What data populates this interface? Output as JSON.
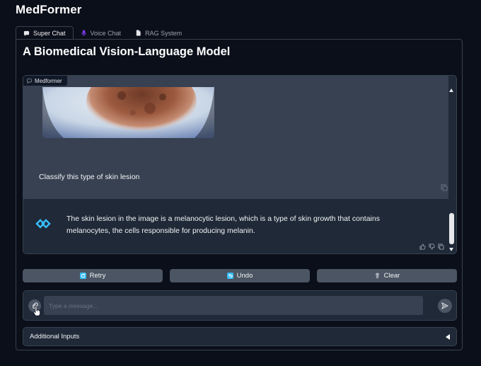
{
  "app": {
    "title": "MedFormer"
  },
  "tabs": [
    {
      "label": "Super Chat",
      "icon": "chat-bubble-icon",
      "active": true
    },
    {
      "label": "Voice Chat",
      "icon": "microphone-icon",
      "active": false
    },
    {
      "label": "RAG System",
      "icon": "document-icon",
      "active": false
    }
  ],
  "main": {
    "heading": "A Biomedical Vision-Language Model",
    "chatbot_label": "Medformer",
    "messages": [
      {
        "role": "user",
        "image": "skin-lesion-image",
        "text": "Classify this type of skin lesion"
      },
      {
        "role": "bot",
        "text": "The skin lesion in the image is a melanocytic lesion, which is a type of skin growth that contains melanocytes, the cells responsible for producing melanin."
      }
    ]
  },
  "buttons": {
    "retry": "Retry",
    "undo": "Undo",
    "clear": "Clear"
  },
  "input": {
    "placeholder": "Type a message...",
    "value": ""
  },
  "accordion": {
    "label": "Additional Inputs"
  },
  "colors": {
    "background": "#0b0f19",
    "panel": "#1f2937",
    "user_bubble": "#374151",
    "button": "#4b5563",
    "bot_accent": "#38bdf8",
    "tab_voice_icon": "#7c3aed"
  }
}
